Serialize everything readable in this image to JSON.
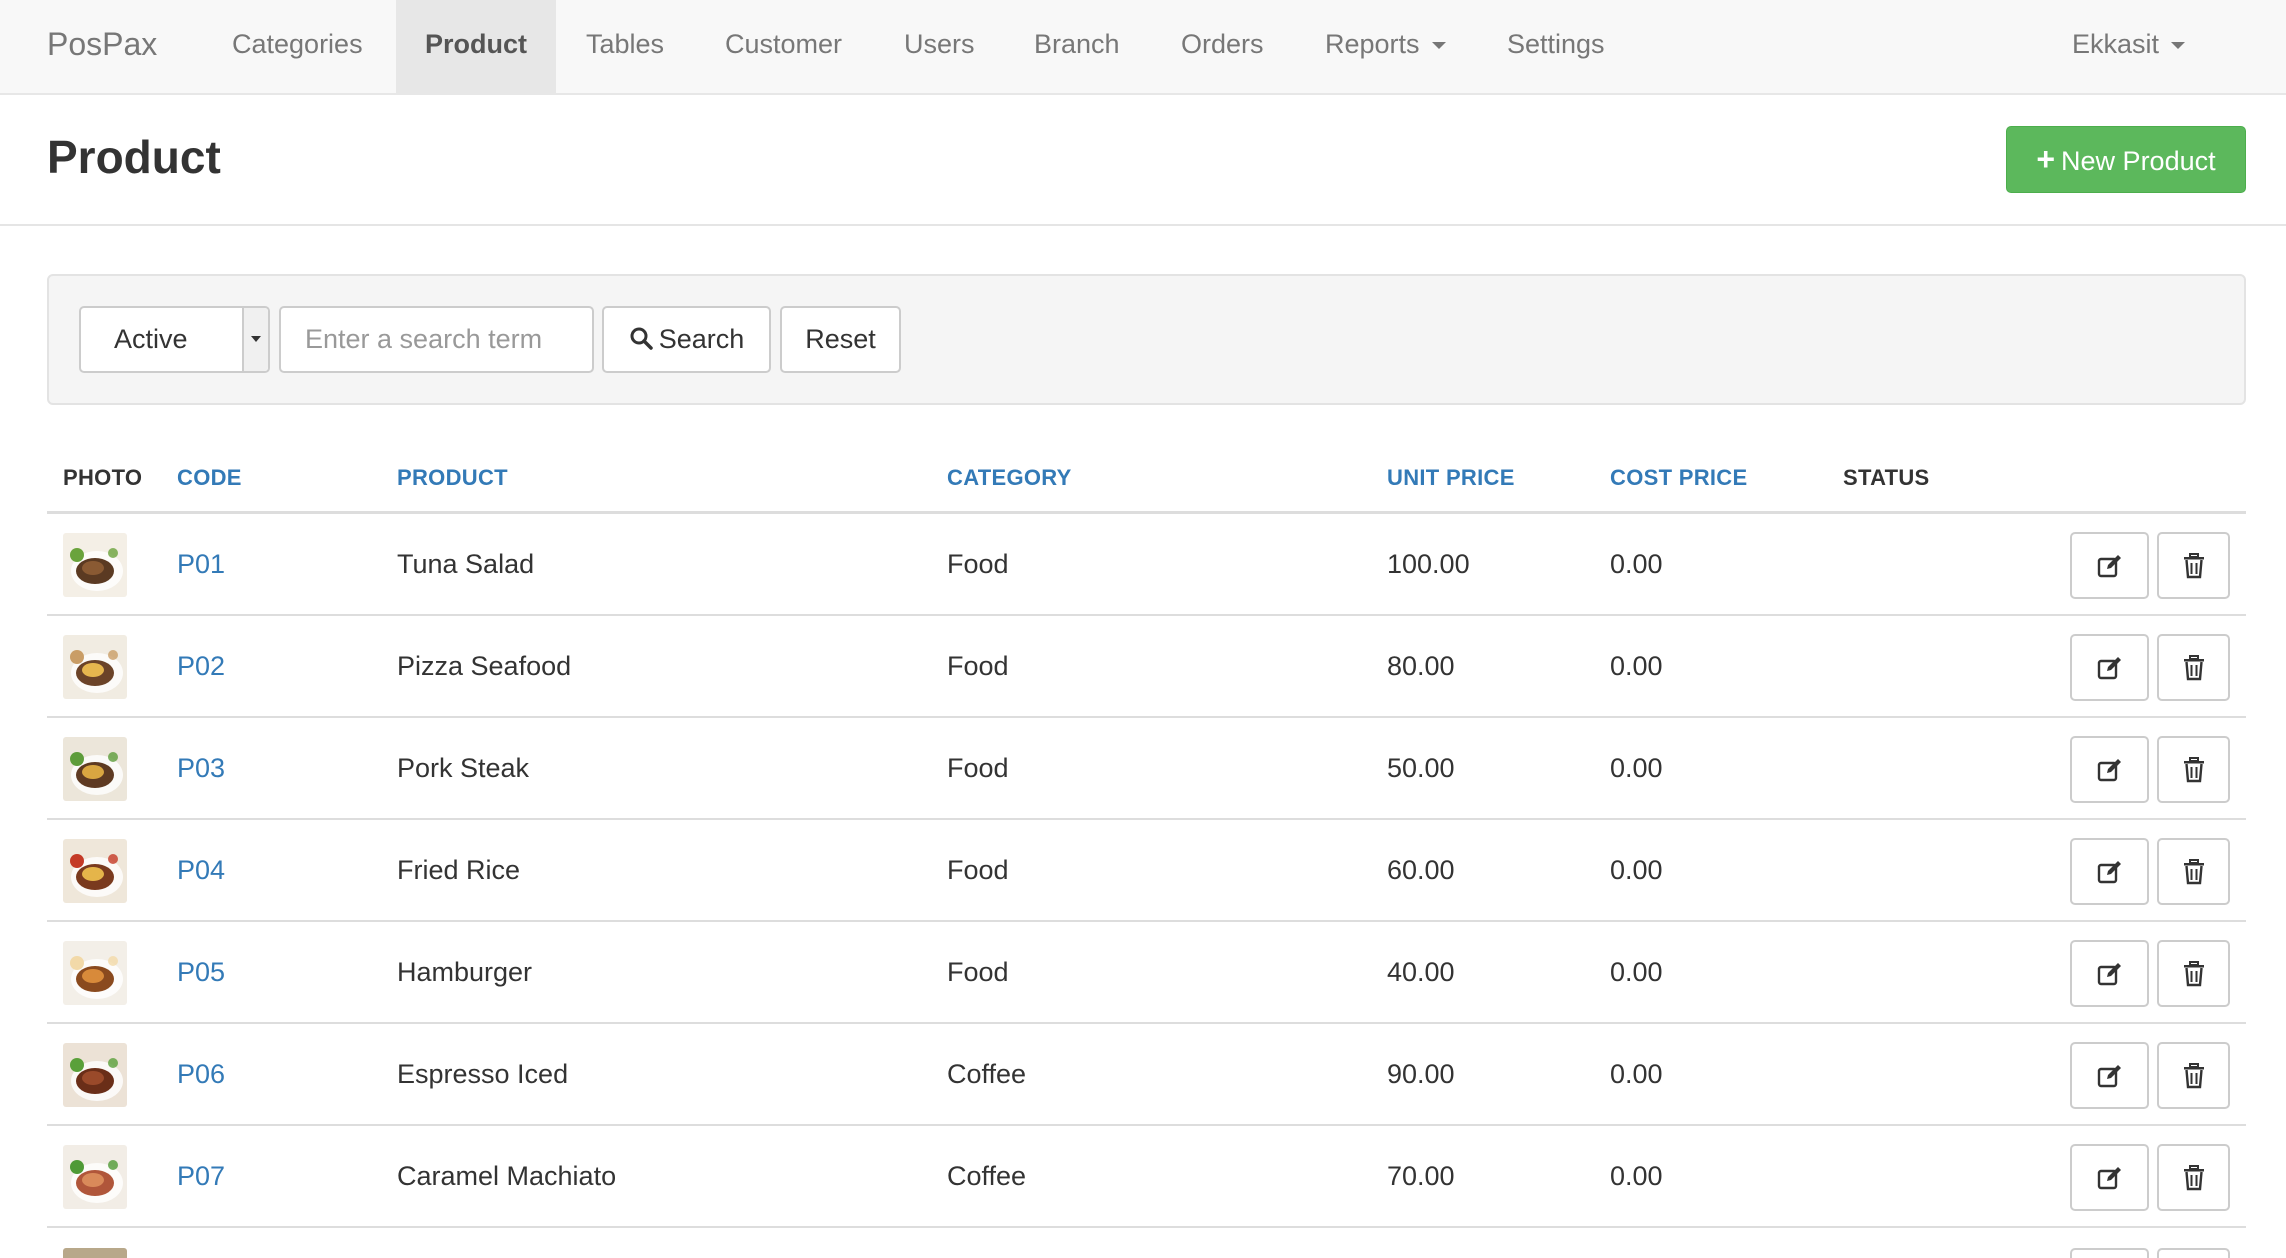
{
  "navbar": {
    "brand": "PosPax",
    "items": [
      {
        "label": "Categories"
      },
      {
        "label": "Product"
      },
      {
        "label": "Tables"
      },
      {
        "label": "Customer"
      },
      {
        "label": "Users"
      },
      {
        "label": "Branch"
      },
      {
        "label": "Orders"
      },
      {
        "label": "Reports"
      },
      {
        "label": "Settings"
      }
    ],
    "active_item": "Product",
    "user": "Ekkasit"
  },
  "page": {
    "title": "Product",
    "new_button_label": "New Product",
    "new_button_color": "#5cb85c"
  },
  "filters": {
    "status_selected": "Active",
    "search_placeholder": "Enter a search term",
    "search_value": "",
    "search_button_label": "Search",
    "reset_button_label": "Reset"
  },
  "table": {
    "columns": [
      "PHOTO",
      "CODE",
      "PRODUCT",
      "CATEGORY",
      "UNIT PRICE",
      "COST PRICE",
      "STATUS"
    ],
    "rows": [
      {
        "code": "P01",
        "product": "Tuna Salad",
        "category": "Food",
        "unit_price": "100.00",
        "cost_price": "0.00",
        "status": "",
        "photo": "steak-dish"
      },
      {
        "code": "P02",
        "product": "Pizza Seafood",
        "category": "Food",
        "unit_price": "80.00",
        "cost_price": "0.00",
        "status": "",
        "photo": "steak-fries"
      },
      {
        "code": "P03",
        "product": "Pork Steak",
        "category": "Food",
        "unit_price": "50.00",
        "cost_price": "0.00",
        "status": "",
        "photo": "steak-vegetables"
      },
      {
        "code": "P04",
        "product": "Fried Rice",
        "category": "Food",
        "unit_price": "60.00",
        "cost_price": "0.00",
        "status": "",
        "photo": "ribs-fries"
      },
      {
        "code": "P05",
        "product": "Hamburger",
        "category": "Food",
        "unit_price": "40.00",
        "cost_price": "0.00",
        "status": "",
        "photo": "burger-plate"
      },
      {
        "code": "P06",
        "product": "Espresso Iced",
        "category": "Coffee",
        "unit_price": "90.00",
        "cost_price": "0.00",
        "status": "",
        "photo": "grilled-ribs"
      },
      {
        "code": "P07",
        "product": "Caramel Machiato",
        "category": "Coffee",
        "unit_price": "70.00",
        "cost_price": "0.00",
        "status": "",
        "photo": "ham-steak"
      }
    ],
    "edit_icon": "edit-icon",
    "delete_icon": "trash-icon",
    "link_color": "#337ab7"
  }
}
